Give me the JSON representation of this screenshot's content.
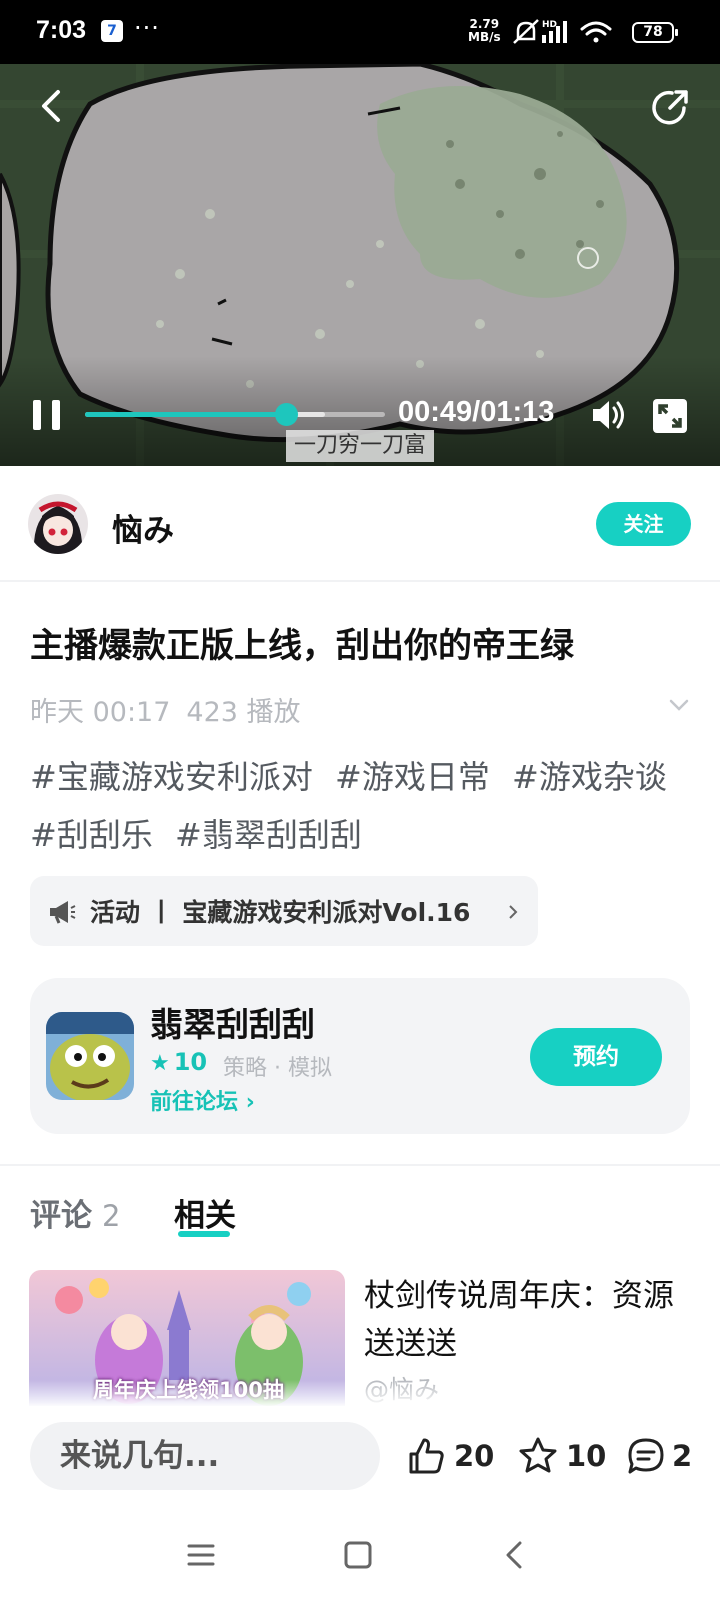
{
  "status_bar": {
    "time": "7:03",
    "app_badge": "7",
    "more": "···",
    "net_speed_value": "2.79",
    "net_speed_unit": "MB/s",
    "signal_label": "HD",
    "battery": "78"
  },
  "video": {
    "current_time": "00:49",
    "duration": "01:13",
    "time_display": "00:49/01:13",
    "progress_fraction": 0.67,
    "subtitle": "一刀穷一刀富"
  },
  "author": {
    "name": "恼み",
    "follow_label": "关注"
  },
  "post": {
    "title": "主播爆款正版上线，刮出你的帝王绿",
    "date": "昨天 00:17",
    "plays": "423 播放",
    "tags": [
      "#宝藏游戏安利派对",
      "#游戏日常",
      "#游戏杂谈",
      "#刮刮乐",
      "#翡翠刮刮刮"
    ]
  },
  "activity": {
    "label": "活动 丨 宝藏游戏安利派对Vol.16"
  },
  "game": {
    "name": "翡翠刮刮刮",
    "score": "10",
    "genre": "策略 · 模拟",
    "forum_link": "前往论坛",
    "reserve_label": "预约"
  },
  "tabs": {
    "comments_label": "评论",
    "comments_count": "2",
    "related_label": "相关"
  },
  "related": [
    {
      "title": "杖剑传说周年庆：资源送送送",
      "author": "@恼み",
      "thumb_caption": "周年庆上线领100抽"
    }
  ],
  "bottom_bar": {
    "comment_placeholder": "来说几句...",
    "likes": "20",
    "favorites": "10",
    "comments": "2"
  },
  "colors": {
    "accent": "#17d0c3",
    "muted_text": "#b6b9be"
  }
}
